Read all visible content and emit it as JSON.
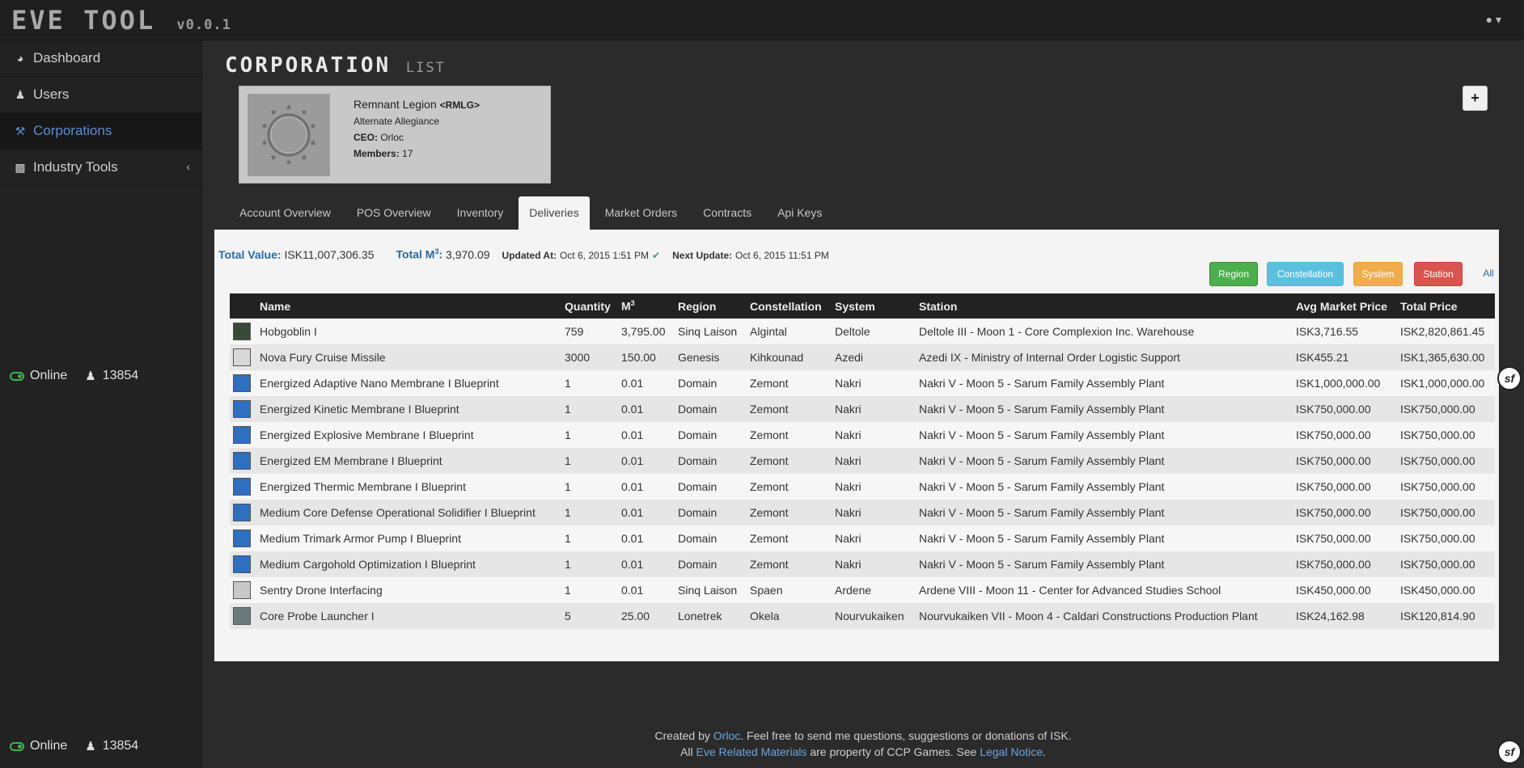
{
  "app": {
    "title": "EVE TOOL",
    "version": "v0.0.1"
  },
  "sidebar": {
    "items": [
      {
        "label": "Dashboard",
        "icon": "dashboard-icon"
      },
      {
        "label": "Users",
        "icon": "user-icon"
      },
      {
        "label": "Corporations",
        "icon": "gavel-icon",
        "active": true
      },
      {
        "label": "Industry Tools",
        "icon": "chart-icon"
      }
    ],
    "status": {
      "label": "Online",
      "count": "13854"
    }
  },
  "page": {
    "title": "CORPORATION",
    "subtitle": "LIST",
    "add_label": "+"
  },
  "corp": {
    "name": "Remnant Legion",
    "ticker": "<RMLG>",
    "alliance": "Alternate Allegiance",
    "ceo_label": "CEO:",
    "ceo": "Orloc",
    "members_label": "Members:",
    "members": "17"
  },
  "tabs": [
    "Account Overview",
    "POS Overview",
    "Inventory",
    "Deliveries",
    "Market Orders",
    "Contracts",
    "Api Keys"
  ],
  "summary": {
    "total_value_label": "Total Value:",
    "total_value": "ISK11,007,306.35",
    "total_m3_label": "Total M",
    "total_m3": "3,970.09",
    "updated_label": "Updated At:",
    "updated": "Oct 6, 2015 1:51 PM",
    "next_label": "Next Update:",
    "next": "Oct 6, 2015 11:51 PM"
  },
  "filters": {
    "region": "Region",
    "constellation": "Constellation",
    "system": "System",
    "station": "Station",
    "all": "All"
  },
  "table": {
    "headers": [
      "Name",
      "Quantity",
      "M",
      "Region",
      "Constellation",
      "System",
      "Station",
      "Avg Market Price",
      "Total Price"
    ],
    "rows": [
      {
        "icon": "drone-icon",
        "color": "#3a4a3a",
        "name": "Hobgoblin I",
        "qty": "759",
        "m3": "3,795.00",
        "region": "Sinq Laison",
        "const": "Algintal",
        "system": "Deltole",
        "station": "Deltole III - Moon 1 - Core Complexion Inc. Warehouse",
        "avg": "ISK3,716.55",
        "total": "ISK2,820,861.45"
      },
      {
        "icon": "missile-icon",
        "color": "#d8d8d8",
        "name": "Nova Fury Cruise Missile",
        "qty": "3000",
        "m3": "150.00",
        "region": "Genesis",
        "const": "Kihkounad",
        "system": "Azedi",
        "station": "Azedi IX - Ministry of Internal Order Logistic Support",
        "avg": "ISK455.21",
        "total": "ISK1,365,630.00"
      },
      {
        "icon": "blueprint-icon",
        "color": "#2e6fc2",
        "name": "Energized Adaptive Nano Membrane I Blueprint",
        "qty": "1",
        "m3": "0.01",
        "region": "Domain",
        "const": "Zemont",
        "system": "Nakri",
        "station": "Nakri V - Moon 5 - Sarum Family Assembly Plant",
        "avg": "ISK1,000,000.00",
        "total": "ISK1,000,000.00"
      },
      {
        "icon": "blueprint-icon",
        "color": "#2e6fc2",
        "name": "Energized Kinetic Membrane I Blueprint",
        "qty": "1",
        "m3": "0.01",
        "region": "Domain",
        "const": "Zemont",
        "system": "Nakri",
        "station": "Nakri V - Moon 5 - Sarum Family Assembly Plant",
        "avg": "ISK750,000.00",
        "total": "ISK750,000.00"
      },
      {
        "icon": "blueprint-icon",
        "color": "#2e6fc2",
        "name": "Energized Explosive Membrane I Blueprint",
        "qty": "1",
        "m3": "0.01",
        "region": "Domain",
        "const": "Zemont",
        "system": "Nakri",
        "station": "Nakri V - Moon 5 - Sarum Family Assembly Plant",
        "avg": "ISK750,000.00",
        "total": "ISK750,000.00"
      },
      {
        "icon": "blueprint-icon",
        "color": "#2e6fc2",
        "name": "Energized EM Membrane I Blueprint",
        "qty": "1",
        "m3": "0.01",
        "region": "Domain",
        "const": "Zemont",
        "system": "Nakri",
        "station": "Nakri V - Moon 5 - Sarum Family Assembly Plant",
        "avg": "ISK750,000.00",
        "total": "ISK750,000.00"
      },
      {
        "icon": "blueprint-icon",
        "color": "#2e6fc2",
        "name": "Energized Thermic Membrane I Blueprint",
        "qty": "1",
        "m3": "0.01",
        "region": "Domain",
        "const": "Zemont",
        "system": "Nakri",
        "station": "Nakri V - Moon 5 - Sarum Family Assembly Plant",
        "avg": "ISK750,000.00",
        "total": "ISK750,000.00"
      },
      {
        "icon": "blueprint-icon",
        "color": "#2e6fc2",
        "name": "Medium Core Defense Operational Solidifier I Blueprint",
        "qty": "1",
        "m3": "0.01",
        "region": "Domain",
        "const": "Zemont",
        "system": "Nakri",
        "station": "Nakri V - Moon 5 - Sarum Family Assembly Plant",
        "avg": "ISK750,000.00",
        "total": "ISK750,000.00"
      },
      {
        "icon": "blueprint-icon",
        "color": "#2e6fc2",
        "name": "Medium Trimark Armor Pump I Blueprint",
        "qty": "1",
        "m3": "0.01",
        "region": "Domain",
        "const": "Zemont",
        "system": "Nakri",
        "station": "Nakri V - Moon 5 - Sarum Family Assembly Plant",
        "avg": "ISK750,000.00",
        "total": "ISK750,000.00"
      },
      {
        "icon": "blueprint-icon",
        "color": "#2e6fc2",
        "name": "Medium Cargohold Optimization I Blueprint",
        "qty": "1",
        "m3": "0.01",
        "region": "Domain",
        "const": "Zemont",
        "system": "Nakri",
        "station": "Nakri V - Moon 5 - Sarum Family Assembly Plant",
        "avg": "ISK750,000.00",
        "total": "ISK750,000.00"
      },
      {
        "icon": "skillbook-icon",
        "color": "#c8c8c8",
        "name": "Sentry Drone Interfacing",
        "qty": "1",
        "m3": "0.01",
        "region": "Sinq Laison",
        "const": "Spaen",
        "system": "Ardene",
        "station": "Ardene VIII - Moon 11 - Center for Advanced Studies School",
        "avg": "ISK450,000.00",
        "total": "ISK450,000.00"
      },
      {
        "icon": "launcher-icon",
        "color": "#6a7a7a",
        "name": "Core Probe Launcher I",
        "qty": "5",
        "m3": "25.00",
        "region": "Lonetrek",
        "const": "Okela",
        "system": "Nourvukaiken",
        "station": "Nourvukaiken VII - Moon 4 - Caldari Constructions Production Plant",
        "avg": "ISK24,162.98",
        "total": "ISK120,814.90"
      }
    ]
  },
  "footer": {
    "line1_pre": "Created by ",
    "author": "Orloc",
    "line1_post": ". Feel free to send me questions, suggestions or donations of ISK.",
    "line2_pre": "All ",
    "materials_link": "Eve Related Materials",
    "line2_mid": " are property of CCP Games. See ",
    "legal_link": "Legal Notice",
    "line2_post": "."
  },
  "colors": {
    "accent": "#5b8ed1",
    "online": "#3bb54a",
    "region": "#4cae4c",
    "constellation": "#5bc0de",
    "system": "#f0ad4e",
    "station": "#d9534f"
  }
}
